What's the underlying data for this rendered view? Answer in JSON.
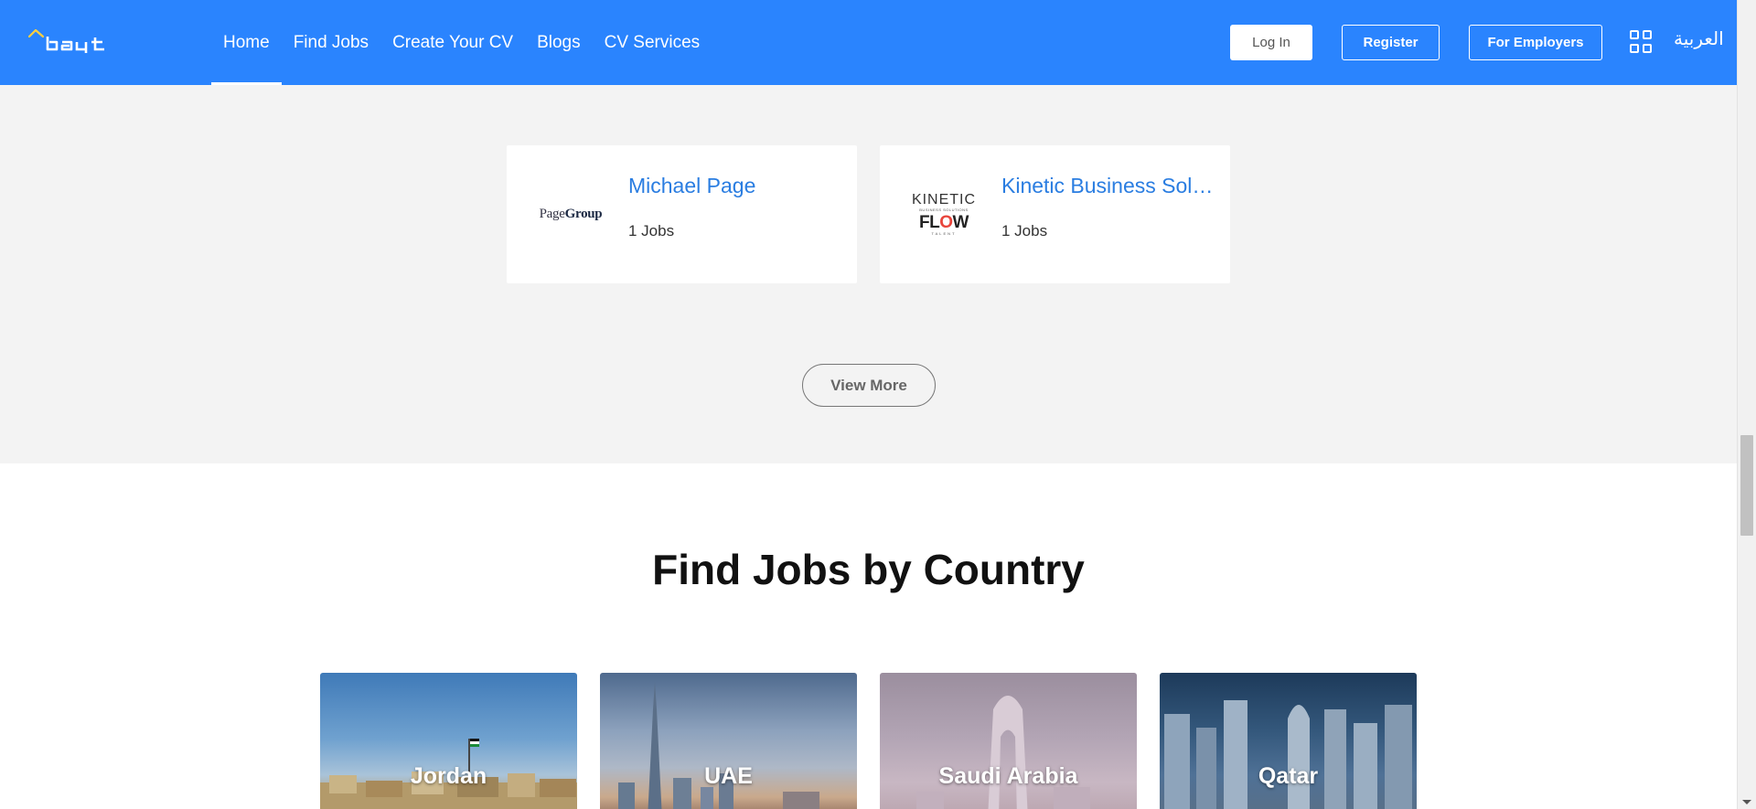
{
  "header": {
    "logo_alt": "bayt",
    "nav": [
      {
        "label": "Home",
        "active": true
      },
      {
        "label": "Find Jobs",
        "active": false
      },
      {
        "label": "Create Your CV",
        "active": false
      },
      {
        "label": "Blogs",
        "active": false
      },
      {
        "label": "CV Services",
        "active": false
      }
    ],
    "login_label": "Log In",
    "register_label": "Register",
    "employers_label": "For Employers",
    "language_label": "العربية",
    "brand_color": "#2a84fe"
  },
  "companies": [
    {
      "name": "Michael Page",
      "jobs": "1 Jobs",
      "logo_text_1": "Page",
      "logo_text_2": "Group"
    },
    {
      "name": "Kinetic Business Solutions",
      "jobs": "1 Jobs",
      "logo_top": "KINETIC",
      "logo_sub": "BUSINESS SOLUTIONS",
      "logo_flow": "FLOW",
      "logo_tal": "TALENT"
    }
  ],
  "view_more_label": "View More",
  "country_section": {
    "title": "Find Jobs by Country",
    "countries": [
      {
        "name": "Jordan"
      },
      {
        "name": "UAE"
      },
      {
        "name": "Saudi Arabia"
      },
      {
        "name": "Qatar"
      }
    ]
  }
}
